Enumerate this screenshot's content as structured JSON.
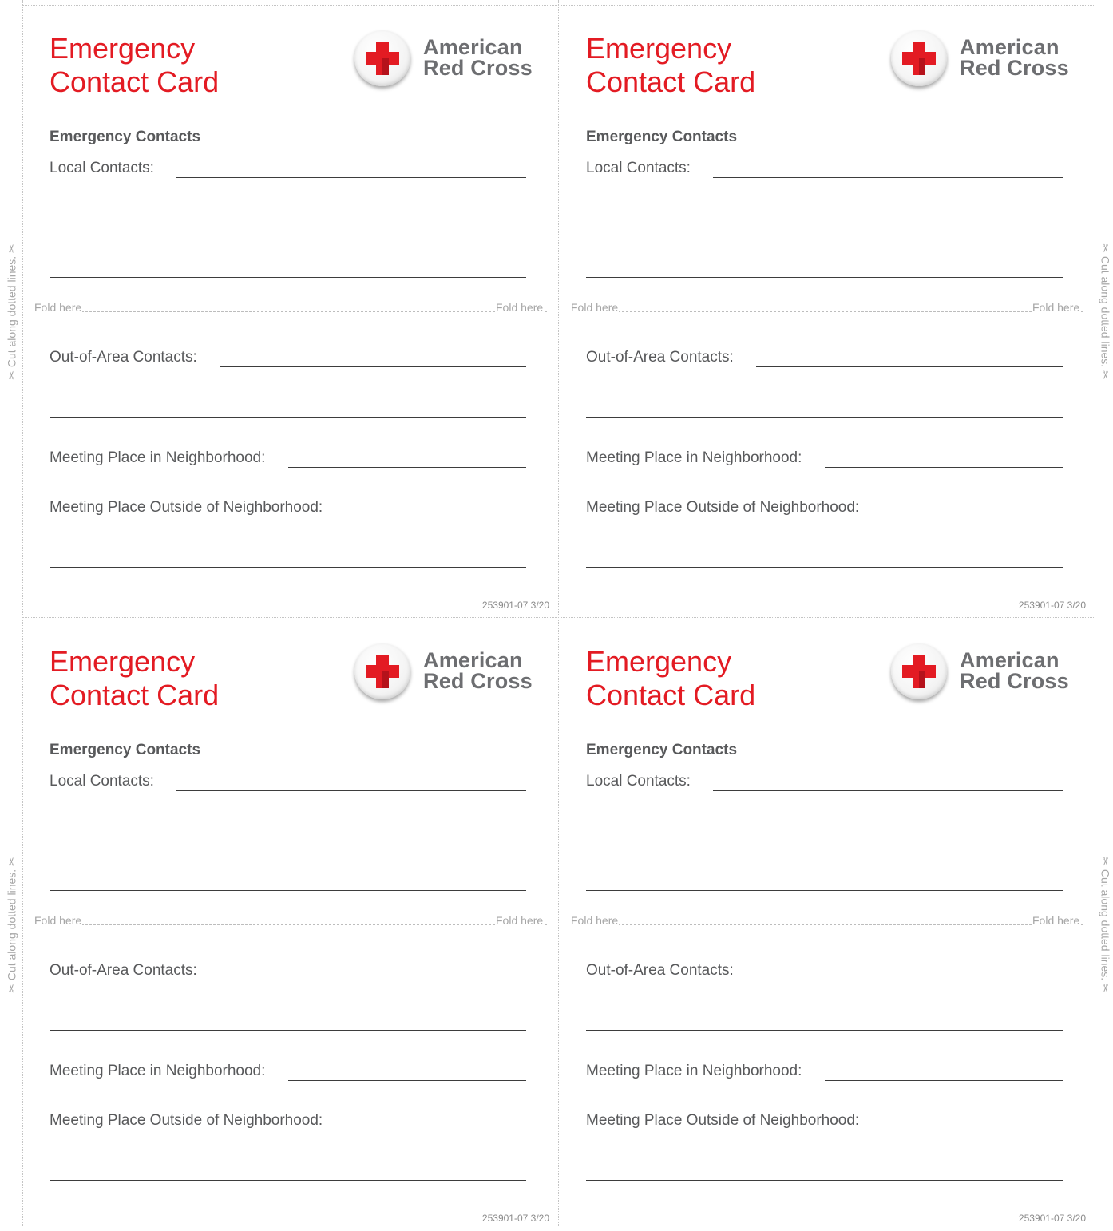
{
  "sheet": {
    "cut_text_left": "✂ Cut along dotted lines. ✂",
    "cut_text_right": "✂ Cut along dotted lines. ✂"
  },
  "colors": {
    "title_red": "#e31b23",
    "text_gray": "#58595b",
    "logo_gray": "#6d6e71"
  },
  "cards": [
    {
      "title_line1": "Emergency",
      "title_line2": "Contact Card",
      "logo_line1": "American",
      "logo_line2": "Red Cross",
      "logo_icon": "red-cross-icon",
      "heading": "Emergency Contacts",
      "local_contacts": "Local Contacts:",
      "fold_left": "Fold here",
      "fold_right": "Fold here",
      "out_of_area": "Out-of-Area Contacts:",
      "meeting_in": "Meeting Place in Neighborhood:",
      "meeting_out": "Meeting Place Outside of Neighborhood:",
      "code": "253901-07 3/20"
    },
    {
      "title_line1": "Emergency",
      "title_line2": "Contact Card",
      "logo_line1": "American",
      "logo_line2": "Red Cross",
      "logo_icon": "red-cross-icon",
      "heading": "Emergency Contacts",
      "local_contacts": "Local Contacts:",
      "fold_left": "Fold here",
      "fold_right": "Fold here",
      "out_of_area": "Out-of-Area Contacts:",
      "meeting_in": "Meeting Place in Neighborhood:",
      "meeting_out": "Meeting Place Outside of Neighborhood:",
      "code": "253901-07 3/20"
    },
    {
      "title_line1": "Emergency",
      "title_line2": "Contact Card",
      "logo_line1": "American",
      "logo_line2": "Red Cross",
      "logo_icon": "red-cross-icon",
      "heading": "Emergency Contacts",
      "local_contacts": "Local Contacts:",
      "fold_left": "Fold here",
      "fold_right": "Fold here",
      "out_of_area": "Out-of-Area Contacts:",
      "meeting_in": "Meeting Place in Neighborhood:",
      "meeting_out": "Meeting Place Outside of Neighborhood:",
      "code": "253901-07 3/20"
    },
    {
      "title_line1": "Emergency",
      "title_line2": "Contact Card",
      "logo_line1": "American",
      "logo_line2": "Red Cross",
      "logo_icon": "red-cross-icon",
      "heading": "Emergency Contacts",
      "local_contacts": "Local Contacts:",
      "fold_left": "Fold here",
      "fold_right": "Fold here",
      "out_of_area": "Out-of-Area Contacts:",
      "meeting_in": "Meeting Place in Neighborhood:",
      "meeting_out": "Meeting Place Outside of Neighborhood:",
      "code": "253901-07 3/20"
    }
  ]
}
